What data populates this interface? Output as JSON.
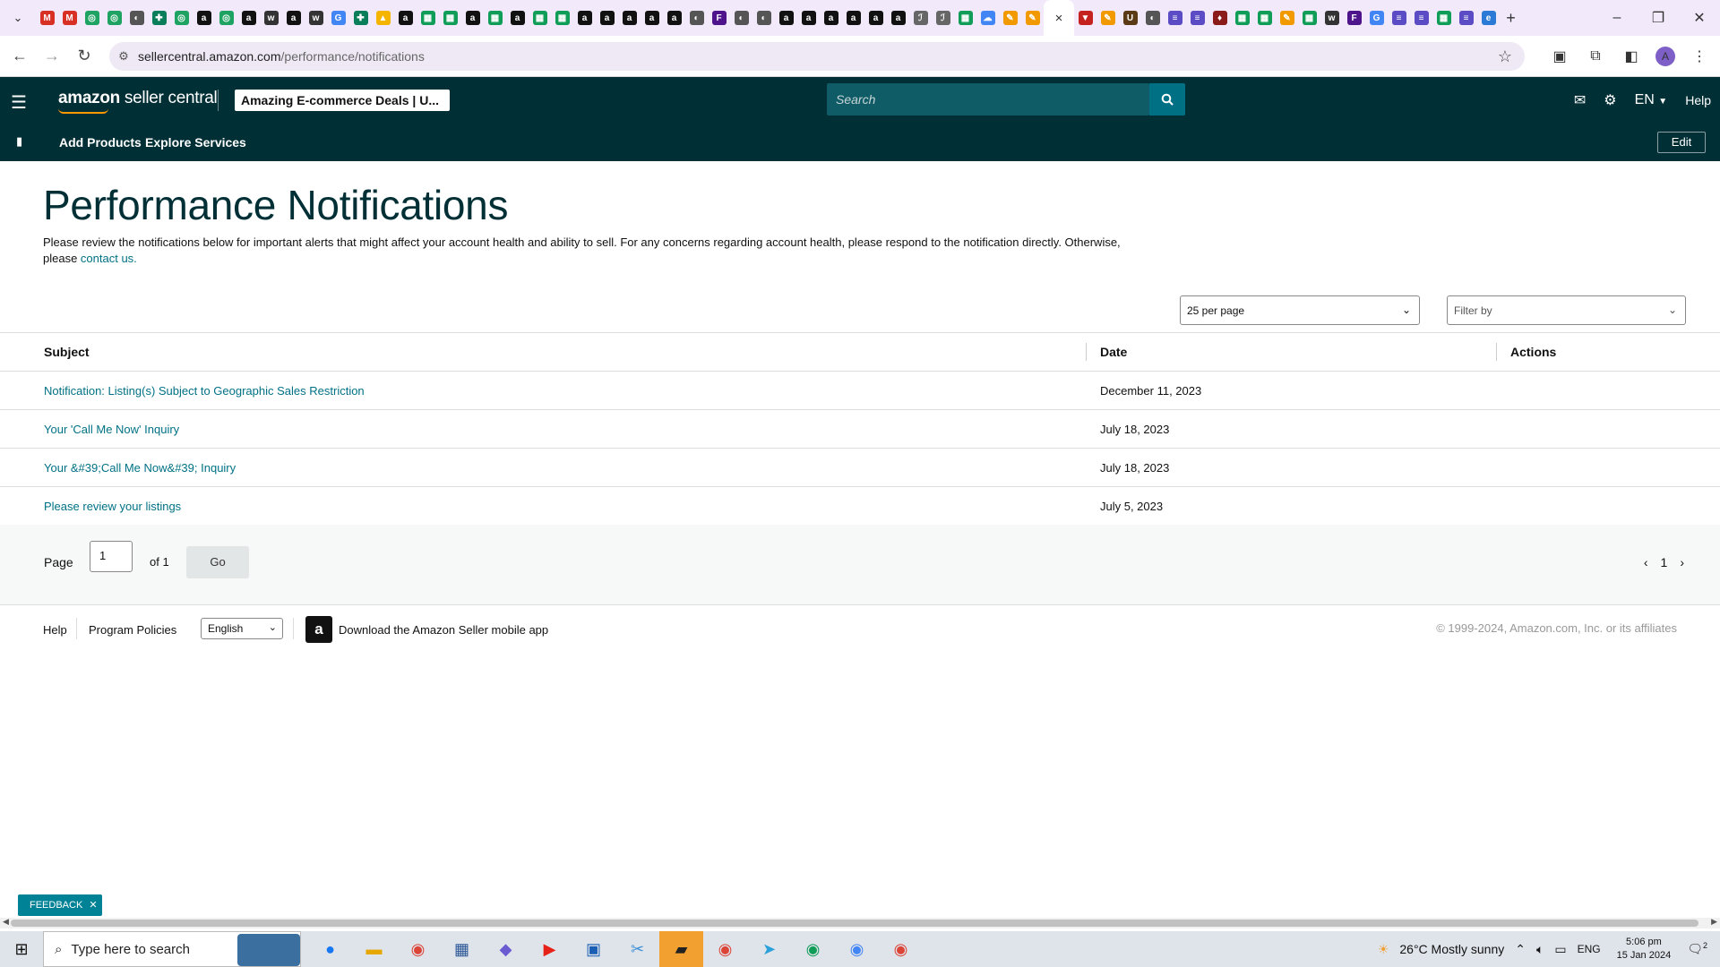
{
  "browser": {
    "url_domain": "sellercentral.amazon.com",
    "url_path": "/performance/notifications",
    "tab_icons": [
      "gmail-icon",
      "gmail-icon",
      "green-circle-icon",
      "green-circle-icon",
      "globe-icon",
      "puzzle-icon",
      "green-circle-icon",
      "amazon-icon",
      "green-circle-icon",
      "amazon-icon",
      "wix-icon",
      "amazon-icon",
      "wix-icon",
      "google-icon",
      "puzzle-icon",
      "drive-icon",
      "amazon-icon",
      "sheets-icon",
      "sheets-icon",
      "amazon-icon",
      "sheets-icon",
      "amazon-icon",
      "sheets-icon",
      "sheets-icon",
      "amazon-icon",
      "amazon-icon",
      "amazon-icon",
      "amazon-icon",
      "amazon-icon",
      "globe-icon",
      "fedex-icon",
      "globe-icon",
      "globe-icon",
      "amazon-icon",
      "amazon-icon",
      "amazon-icon",
      "amazon-icon",
      "amazon-icon",
      "amazon-icon",
      "pen-icon",
      "pen-icon",
      "sheets-icon",
      "cloud-icon",
      "pencil-icon",
      "pencil-icon"
    ],
    "tab_icons_right": [
      "shield-icon",
      "pencil-icon",
      "ups-icon",
      "globe-icon",
      "docs-icon",
      "docs-icon",
      "ticket-icon",
      "sheets-icon",
      "sheets-icon",
      "pencil-icon",
      "sheets-icon",
      "wix-icon",
      "fedex-icon",
      "google-icon",
      "docs-icon",
      "docs-icon",
      "sheets-icon",
      "docs-icon",
      "edge-icon"
    ],
    "active_tab_close": "×",
    "new_tab": "+",
    "avatar_letter": "A"
  },
  "header": {
    "logo_bold": "amazon",
    "logo_rest": " seller central",
    "store_name": "Amazing E-commerce Deals | U...",
    "search_placeholder": "Search",
    "language": "EN",
    "help": "Help"
  },
  "subnav": {
    "items": [
      "Add Products",
      "Explore Services"
    ],
    "edit": "Edit"
  },
  "main": {
    "title": "Performance Notifications",
    "intro": "Please review the notifications below for important alerts that might affect your account health and ability to sell. For any concerns regarding account health, please respond to the notification directly. Otherwise, please ",
    "intro_link": "contact us.",
    "per_page": "25 per page",
    "filter": "Filter by",
    "columns": [
      "Subject",
      "Date",
      "Actions"
    ],
    "rows": [
      {
        "subject": "Notification: Listing(s) Subject to Geographic Sales Restriction",
        "date": "December 11, 2023"
      },
      {
        "subject": "Your 'Call Me Now' Inquiry",
        "date": "July 18, 2023"
      },
      {
        "subject": "Your &#39;Call Me Now&#39; Inquiry",
        "date": "July 18, 2023"
      },
      {
        "subject": "Please review your listings",
        "date": "July 5, 2023"
      }
    ]
  },
  "pager": {
    "page_label": "Page",
    "page_value": "1",
    "of_label": "of 1",
    "go": "Go",
    "current": "1"
  },
  "footer": {
    "help": "Help",
    "policies": "Program Policies",
    "language": "English",
    "app": "Download the Amazon Seller mobile app",
    "copyright": "© 1999-2024, Amazon.com, Inc. or its affiliates"
  },
  "feedback": "FEEDBACK",
  "taskbar": {
    "search": "Type here to search",
    "weather": "26°C  Mostly sunny",
    "lang": "ENG",
    "time": "5:06 pm",
    "date": "15 Jan 2024",
    "notif": "2"
  },
  "colors": {
    "nav_bg": "#002f36",
    "link": "#007185",
    "tabstrip": "#f2e9fb"
  }
}
